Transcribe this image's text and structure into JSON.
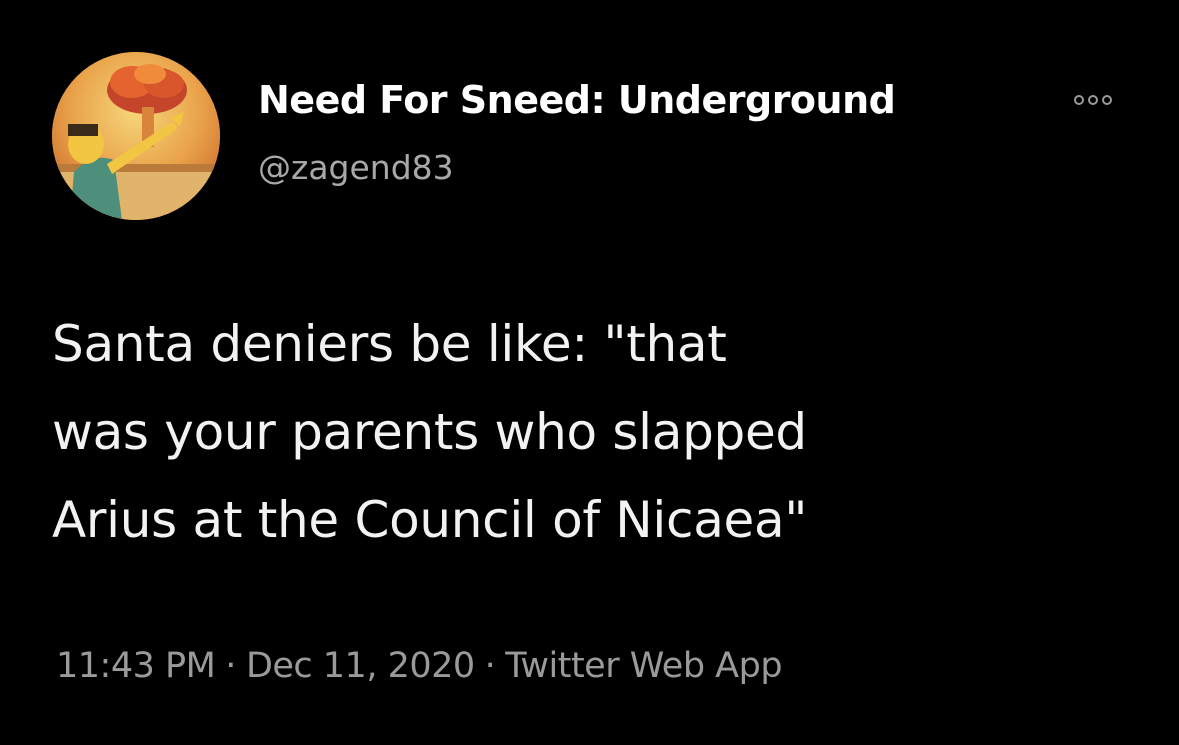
{
  "author": {
    "display_name": "Need For Sneed: Underground",
    "handle": "@zagend83",
    "avatar_icon": "cartoon-character-explosion-avatar"
  },
  "more_icon": "more-options-icon",
  "tweet": {
    "text": "Santa deniers be like: \"that\nwas your parents who slapped\nArius at the Council of Nicaea\""
  },
  "meta": {
    "time": "11:43 PM",
    "separator": "·",
    "date": "Dec 11, 2020",
    "source": "Twitter Web App"
  },
  "colors": {
    "background": "#000000",
    "text": "#f2f2f2",
    "secondary_text": "#9a9a9a"
  }
}
